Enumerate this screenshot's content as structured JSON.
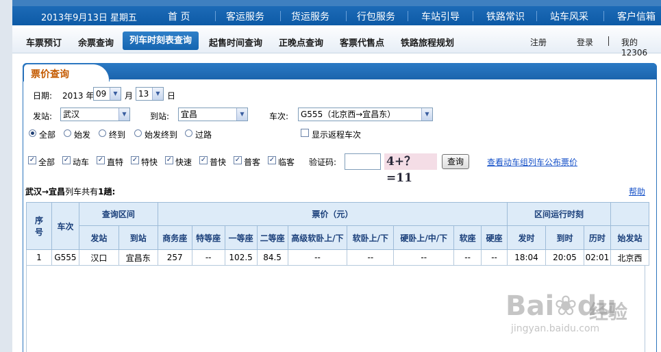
{
  "topnav": {
    "date": "2013年9月13日 星期五",
    "items": [
      "首 页",
      "客运服务",
      "货运服务",
      "行包服务",
      "车站引导",
      "铁路常识",
      "站车风采",
      "客户信箱"
    ]
  },
  "menu": {
    "items": [
      "车票预订",
      "余票查询",
      "列车时刻表查询",
      "起售时间查询",
      "正晚点查询",
      "客票代售点",
      "铁路旅程规划"
    ],
    "register": "注册",
    "login": "登录",
    "my12306": "我的12306"
  },
  "panel": {
    "title": "票价查询",
    "date_label": "日期:",
    "year": "2013 年",
    "month_value": "09",
    "month_label": "月",
    "day_value": "13",
    "day_label": "日",
    "from_label": "发站:",
    "from_value": "武汉",
    "to_label": "到站:",
    "to_value": "宜昌",
    "train_label": "车次:",
    "train_value": "G555（北京西→宜昌东）",
    "radios": [
      "全部",
      "始发",
      "终到",
      "始发终到",
      "过路"
    ],
    "return_label": "显示返程车次",
    "types": [
      "全部",
      "动车",
      "直特",
      "特快",
      "快速",
      "普快",
      "普客",
      "临客"
    ],
    "captcha_label": "验证码:",
    "captcha_text": "4+？=11",
    "query_button": "查询",
    "emu_link": "查看动车组列车公布票价"
  },
  "result": {
    "route": "武汉→宜昌",
    "count_pre": "列车共有",
    "count": "1",
    "count_post": "趟:",
    "help": "帮助",
    "headers": {
      "seq": "序号",
      "train": "车次",
      "interval": "查询区间",
      "price": "票价（元）",
      "runtime": "区间运行时刻",
      "from": "发站",
      "to": "到站",
      "classes": [
        "商务座",
        "特等座",
        "一等座",
        "二等座",
        "高级软卧上/下",
        "软卧上/下",
        "硬卧上/中/下",
        "软座",
        "硬座"
      ],
      "depart": "发时",
      "arrive": "到时",
      "duration": "历时",
      "origin": "始发站"
    },
    "rows": [
      {
        "seq": "1",
        "train": "G555",
        "from": "汉口",
        "to": "宜昌东",
        "prices": [
          "257",
          "--",
          "102.5",
          "84.5",
          "--",
          "--",
          "--",
          "--",
          "--"
        ],
        "depart": "18:04",
        "arrive": "20:05",
        "duration": "02:01",
        "origin": "北京西"
      }
    ]
  },
  "watermark": {
    "brand": "Bai",
    "brand2": "du",
    "cn": "经验",
    "url": "jingyan.baidu.com"
  }
}
